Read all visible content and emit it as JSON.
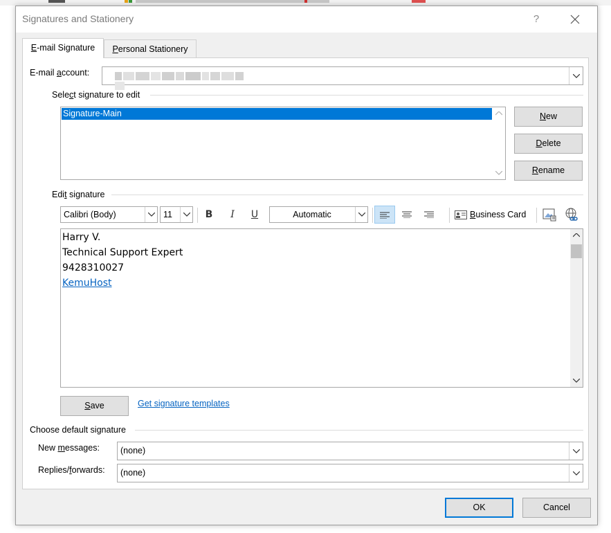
{
  "window": {
    "title": "Signatures and Stationery",
    "help_label": "?"
  },
  "tabs": {
    "email_signature": {
      "prefix": "E",
      "rest": "-mail Signature"
    },
    "personal_stationery": {
      "prefix": "P",
      "rest": "ersonal Stationery"
    }
  },
  "email_account": {
    "label_a": "E-mail ",
    "label_u": "a",
    "label_b": "ccount:",
    "value_redacted": true
  },
  "select_signature": {
    "label_a": "Sele",
    "label_u": "c",
    "label_b": "t signature to edit",
    "items": [
      "Signature-Main"
    ],
    "selected_index": 0
  },
  "buttons": {
    "new": {
      "u": "N",
      "rest": "ew"
    },
    "delete": {
      "u": "D",
      "rest": "elete"
    },
    "rename": {
      "u": "R",
      "rest": "ename"
    },
    "save": {
      "u": "S",
      "rest": "ave"
    },
    "ok": "OK",
    "cancel": "Cancel"
  },
  "edit_signature": {
    "label_a": "Edi",
    "label_u": "t",
    "label_b": " signature",
    "font": "Calibri (Body)",
    "size": "11",
    "bold": "B",
    "italic": "I",
    "underline": "U",
    "color": "Automatic",
    "business_card_u": "B",
    "business_card_rest": "usiness Card",
    "alignment_selected": "left",
    "content": {
      "name": "Harry V.",
      "role": "Technical Support Expert",
      "phone": "9428310027",
      "link_text": "KemuHost"
    }
  },
  "templates_link": "Get signature templates",
  "default_signature": {
    "heading": "Choose default signature",
    "new_messages_label_a": "New ",
    "new_messages_label_u": "m",
    "new_messages_label_b": "essages:",
    "new_messages_value": "(none)",
    "replies_label_a": "Replies/",
    "replies_label_u": "f",
    "replies_label_b": "orwards:",
    "replies_value": "(none)"
  },
  "colors": {
    "selection": "#0078d7",
    "link": "#0563c1",
    "primary_border": "#0078d7"
  }
}
